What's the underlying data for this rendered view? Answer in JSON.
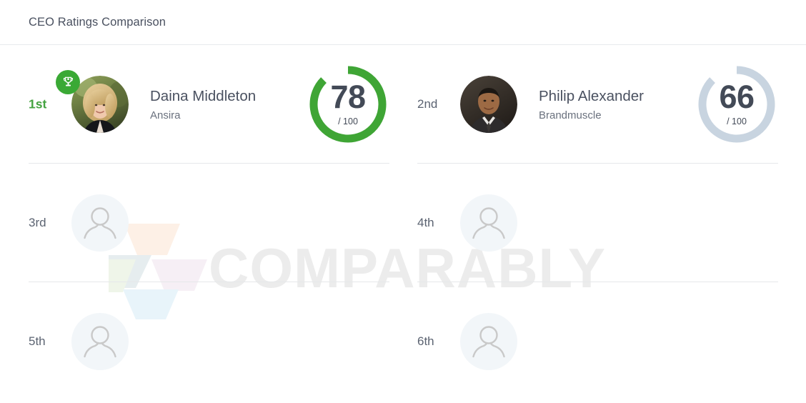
{
  "header": {
    "title": "CEO Ratings Comparison"
  },
  "watermark": {
    "text": "COMPARABLY",
    "logo_icon": "comparably-logo-icon",
    "colors": {
      "peach": "#fdf0e6",
      "slate": "#e6edef",
      "green": "#eff5e9",
      "pink": "#f6eff5",
      "blue": "#e8f4fa"
    }
  },
  "gauge_colors": {
    "first": "#3fa535",
    "second": "#c8d4e0",
    "score_text": "#434a57"
  },
  "rank_colors": {
    "first": "#44a340",
    "other": "#5b6371"
  },
  "badge": {
    "icon": "trophy-icon",
    "background": "#3aa935"
  },
  "entries": [
    {
      "rank": "1st",
      "is_first": true,
      "has_person": true,
      "has_badge": true,
      "avatar_icon": "ceo-photo-daina-middleton",
      "name": "Daina Middleton",
      "company": "Ansira",
      "score": "78",
      "total": "/ 100",
      "score_percent": 78,
      "column": "left"
    },
    {
      "rank": "2nd",
      "is_first": false,
      "has_person": true,
      "has_badge": false,
      "avatar_icon": "ceo-photo-philip-alexander",
      "name": "Philip Alexander",
      "company": "Brandmuscle",
      "score": "66",
      "total": "/ 100",
      "score_percent": 66,
      "column": "right"
    },
    {
      "rank": "3rd",
      "is_first": false,
      "has_person": false,
      "has_badge": false,
      "avatar_icon": "person-placeholder-icon",
      "name": "",
      "company": "",
      "score": "",
      "total": "",
      "column": "left"
    },
    {
      "rank": "4th",
      "is_first": false,
      "has_person": false,
      "has_badge": false,
      "avatar_icon": "person-placeholder-icon",
      "name": "",
      "company": "",
      "score": "",
      "total": "",
      "column": "right"
    },
    {
      "rank": "5th",
      "is_first": false,
      "has_person": false,
      "has_badge": false,
      "avatar_icon": "person-placeholder-icon",
      "name": "",
      "company": "",
      "score": "",
      "total": "",
      "column": "left"
    },
    {
      "rank": "6th",
      "is_first": false,
      "has_person": false,
      "has_badge": false,
      "avatar_icon": "person-placeholder-icon",
      "name": "",
      "company": "",
      "score": "",
      "total": "",
      "column": "right"
    }
  ]
}
